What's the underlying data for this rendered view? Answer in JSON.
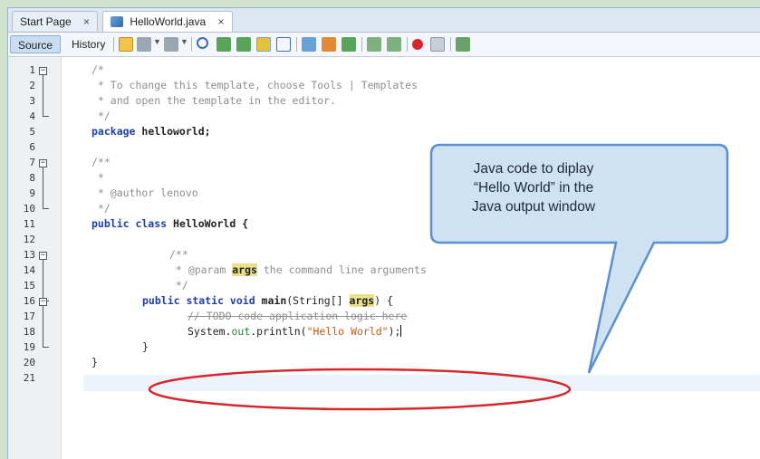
{
  "tabs": [
    {
      "label": "Start Page",
      "close": "×"
    },
    {
      "label": "HelloWorld.java",
      "close": "×"
    }
  ],
  "toolbar": {
    "source_label": "Source",
    "history_label": "History"
  },
  "icons": [
    "format-icon",
    "previous-bookmark-icon",
    "next-bookmark-icon",
    "find-icon",
    "find-previous-icon",
    "find-next-icon",
    "toggle-highlight-icon",
    "toggle-rect-select-icon",
    "shift-left-icon",
    "shift-right-icon",
    "comment-icon",
    "uncomment-icon",
    "record-macro-icon",
    "stop-macro-icon",
    "diff-icon"
  ],
  "line_numbers": [
    "1",
    "2",
    "3",
    "4",
    "5",
    "6",
    "7",
    "8",
    "9",
    "10",
    "11",
    "12",
    "13",
    "14",
    "15",
    "16",
    "17",
    "18",
    "19",
    "20",
    "21"
  ],
  "code": {
    "l1": "/*",
    "l2": " * To change this template, choose Tools | Templates",
    "l3": " * and open the template in the editor.",
    "l4": " */",
    "l5_kw": "package",
    "l5_rest": " helloworld;",
    "l7": "/**",
    "l8": " *",
    "l9": " * @author lenovo",
    "l10": " */",
    "l11_kw": "public class",
    "l11_rest": " HelloWorld {",
    "l13": "/**",
    "l14_a": " * @param ",
    "l14_b": "args",
    "l14_c": " the command line arguments",
    "l15": " */",
    "l16_kw": "public static void",
    "l16_fn": " main",
    "l16_b": "(String[] ",
    "l16_arg": "args",
    "l16_c": ") {",
    "l17": "// TODO code application logic here",
    "l18_a": "System.",
    "l18_out": "out",
    "l18_b": ".println(",
    "l18_str": "\"Hello World\"",
    "l18_c": ");",
    "l19": "}",
    "l20": "}"
  },
  "callout": {
    "line1": "Java code to diplay",
    "line2": "“Hello World” in the",
    "line3": "Java output window"
  },
  "colors": {
    "callout_fill": "#cfe2f3",
    "callout_border": "#5b8fcf",
    "ellipse": "#d9262c",
    "keyword": "#1f3fa8",
    "string": "#c85a12"
  }
}
